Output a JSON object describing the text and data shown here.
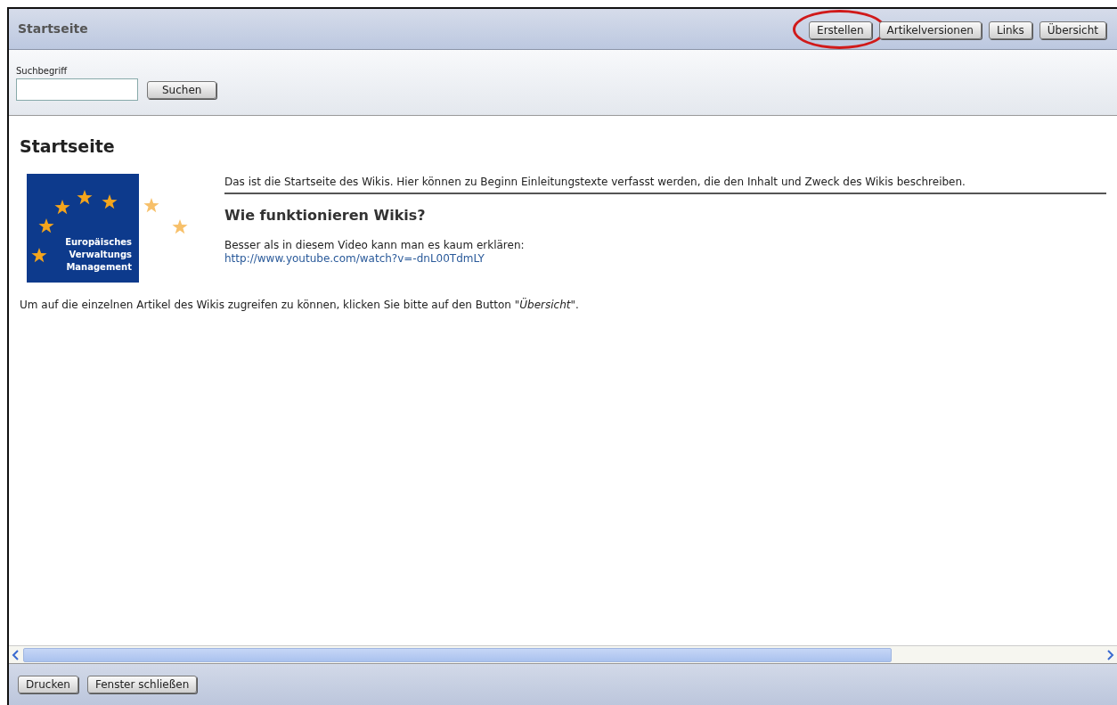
{
  "header": {
    "title": "Startseite",
    "buttons": [
      {
        "label": "Erstellen",
        "highlighted": true
      },
      {
        "label": "Artikelversionen",
        "highlighted": false
      },
      {
        "label": "Links",
        "highlighted": false
      },
      {
        "label": "Übersicht",
        "highlighted": false
      }
    ]
  },
  "search": {
    "label": "Suchbegriff",
    "button": "Suchen"
  },
  "article": {
    "title": "Startseite",
    "logo": {
      "lines": [
        "Europäisches",
        "Verwaltungs",
        "Management"
      ]
    },
    "intro": "Das ist die Startseite des Wikis. Hier können zu Beginn Einleitungstexte verfasst werden, die den Inhalt und Zweck des Wikis beschreiben.",
    "subheading": "Wie funktionieren Wikis?",
    "video_text": "Besser als in diesem Video kann man es kaum erklären:",
    "video_link": "http://www.youtube.com/watch?v=-dnL00TdmLY",
    "footer_note": "Um auf die einzelnen Artikel des Wikis zugreifen zu können, klicken Sie bitte auf den Button \"*Übersicht*\"."
  },
  "footer": {
    "buttons": [
      "Drucken",
      "Fenster schließen"
    ]
  }
}
